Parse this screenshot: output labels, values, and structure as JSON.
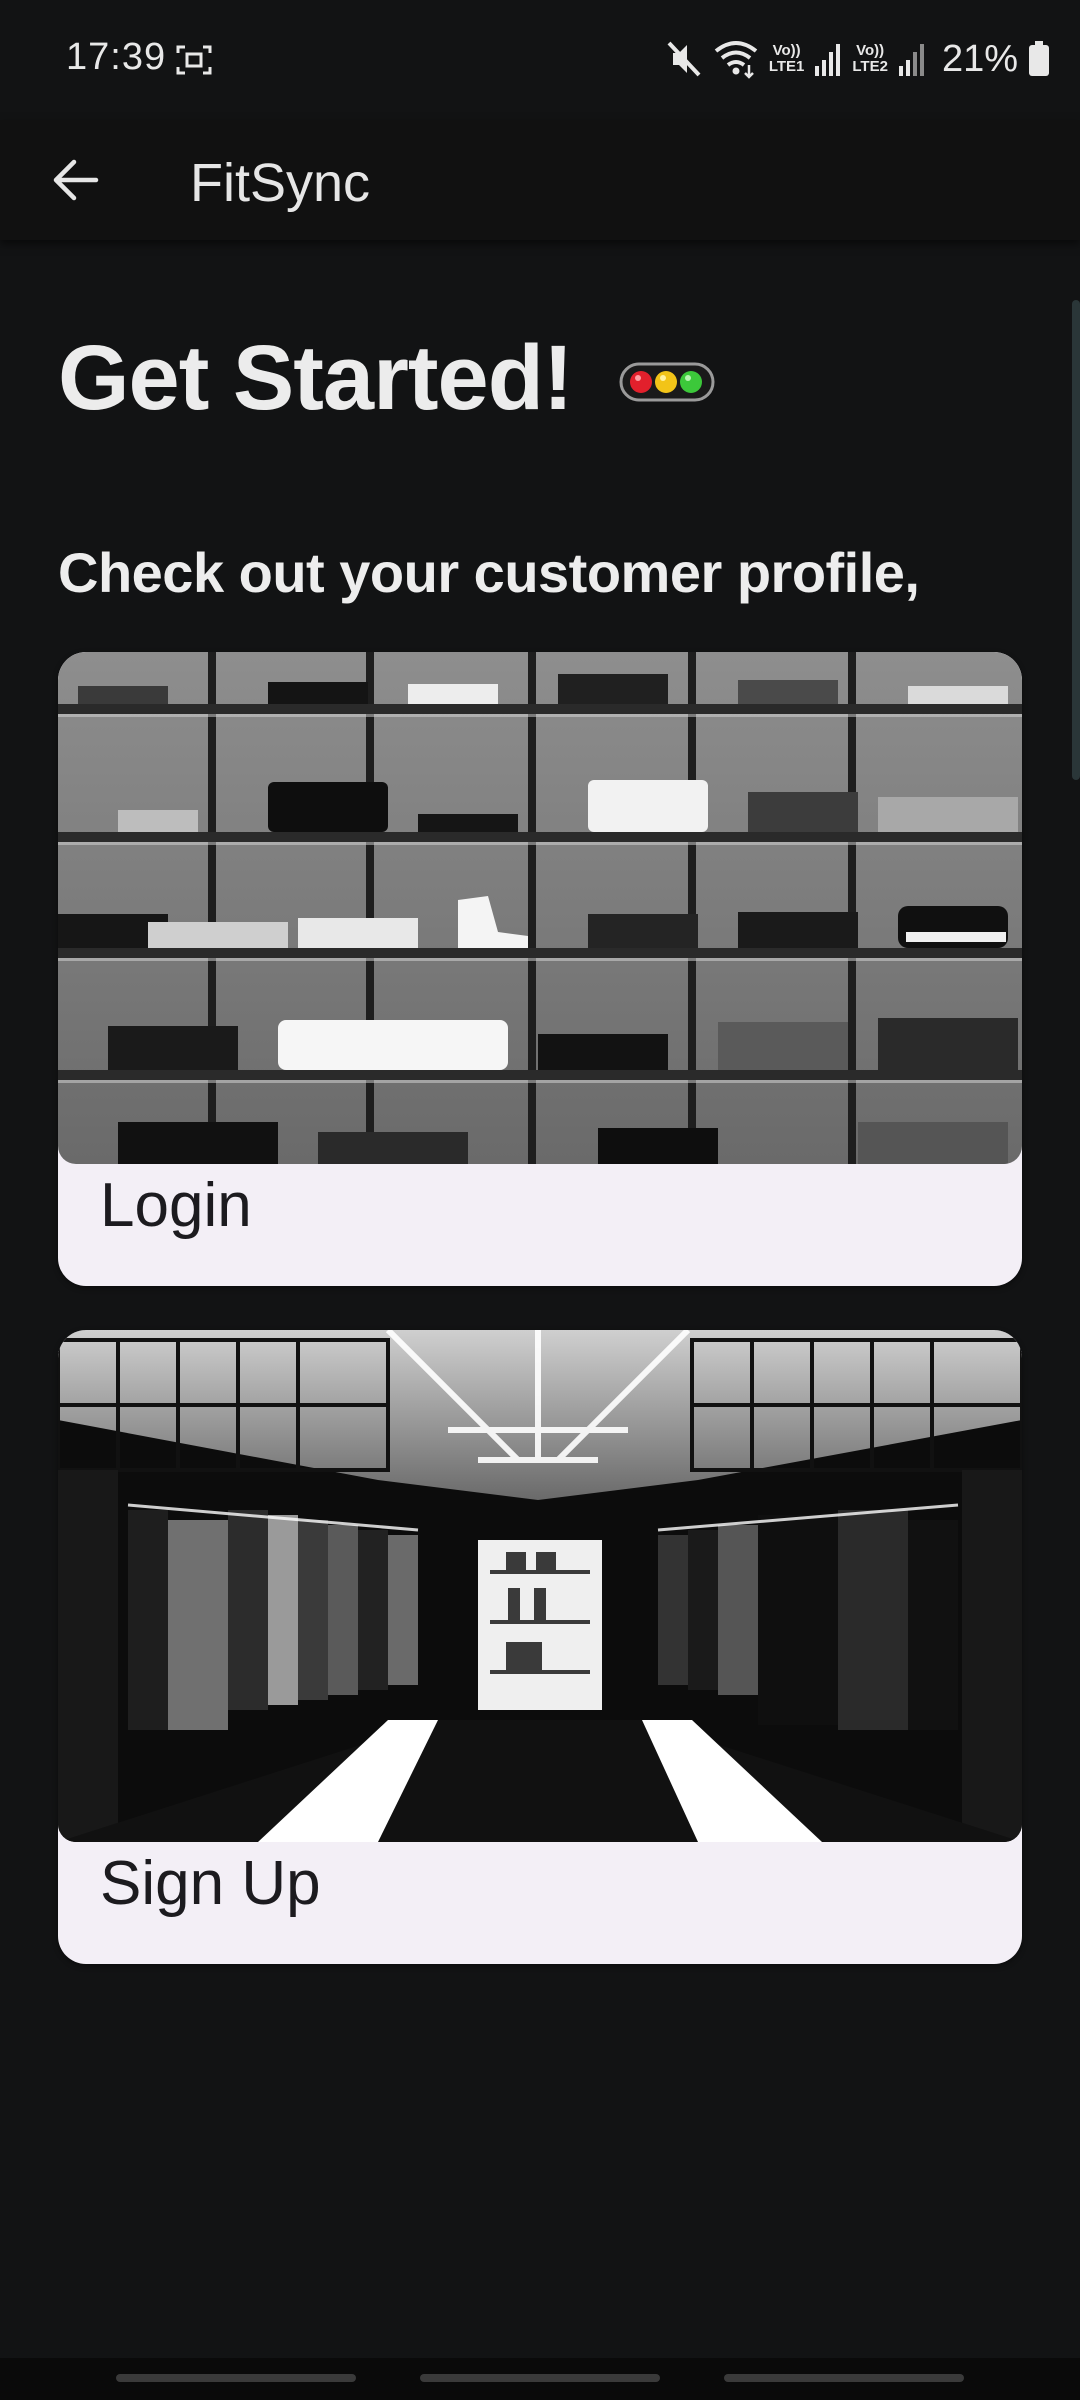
{
  "status_bar": {
    "time": "17:39",
    "lte1_label": "Vo))\nLTE1",
    "lte2_label": "Vo))\nLTE2",
    "battery_percent": "21%",
    "icons": [
      "screenshot-icon",
      "mute-icon",
      "wifi-icon",
      "signal-icon",
      "battery-icon"
    ]
  },
  "app_bar": {
    "title": "FitSync",
    "back_icon": "arrow-left-icon"
  },
  "main": {
    "heading": "Get Started!",
    "heading_icon": "traffic-light-icon",
    "subheading": "Check out your customer profile,"
  },
  "cards": [
    {
      "label": "Login",
      "image": "clothing-shelves-photo"
    },
    {
      "label": "Sign Up",
      "image": "clothing-store-interior-photo"
    }
  ],
  "colors": {
    "background": "#121314",
    "app_bar": "#111111",
    "card": "#F3EFF6",
    "card_text": "#1C1B1F",
    "heading_text": "#ECECEC"
  }
}
